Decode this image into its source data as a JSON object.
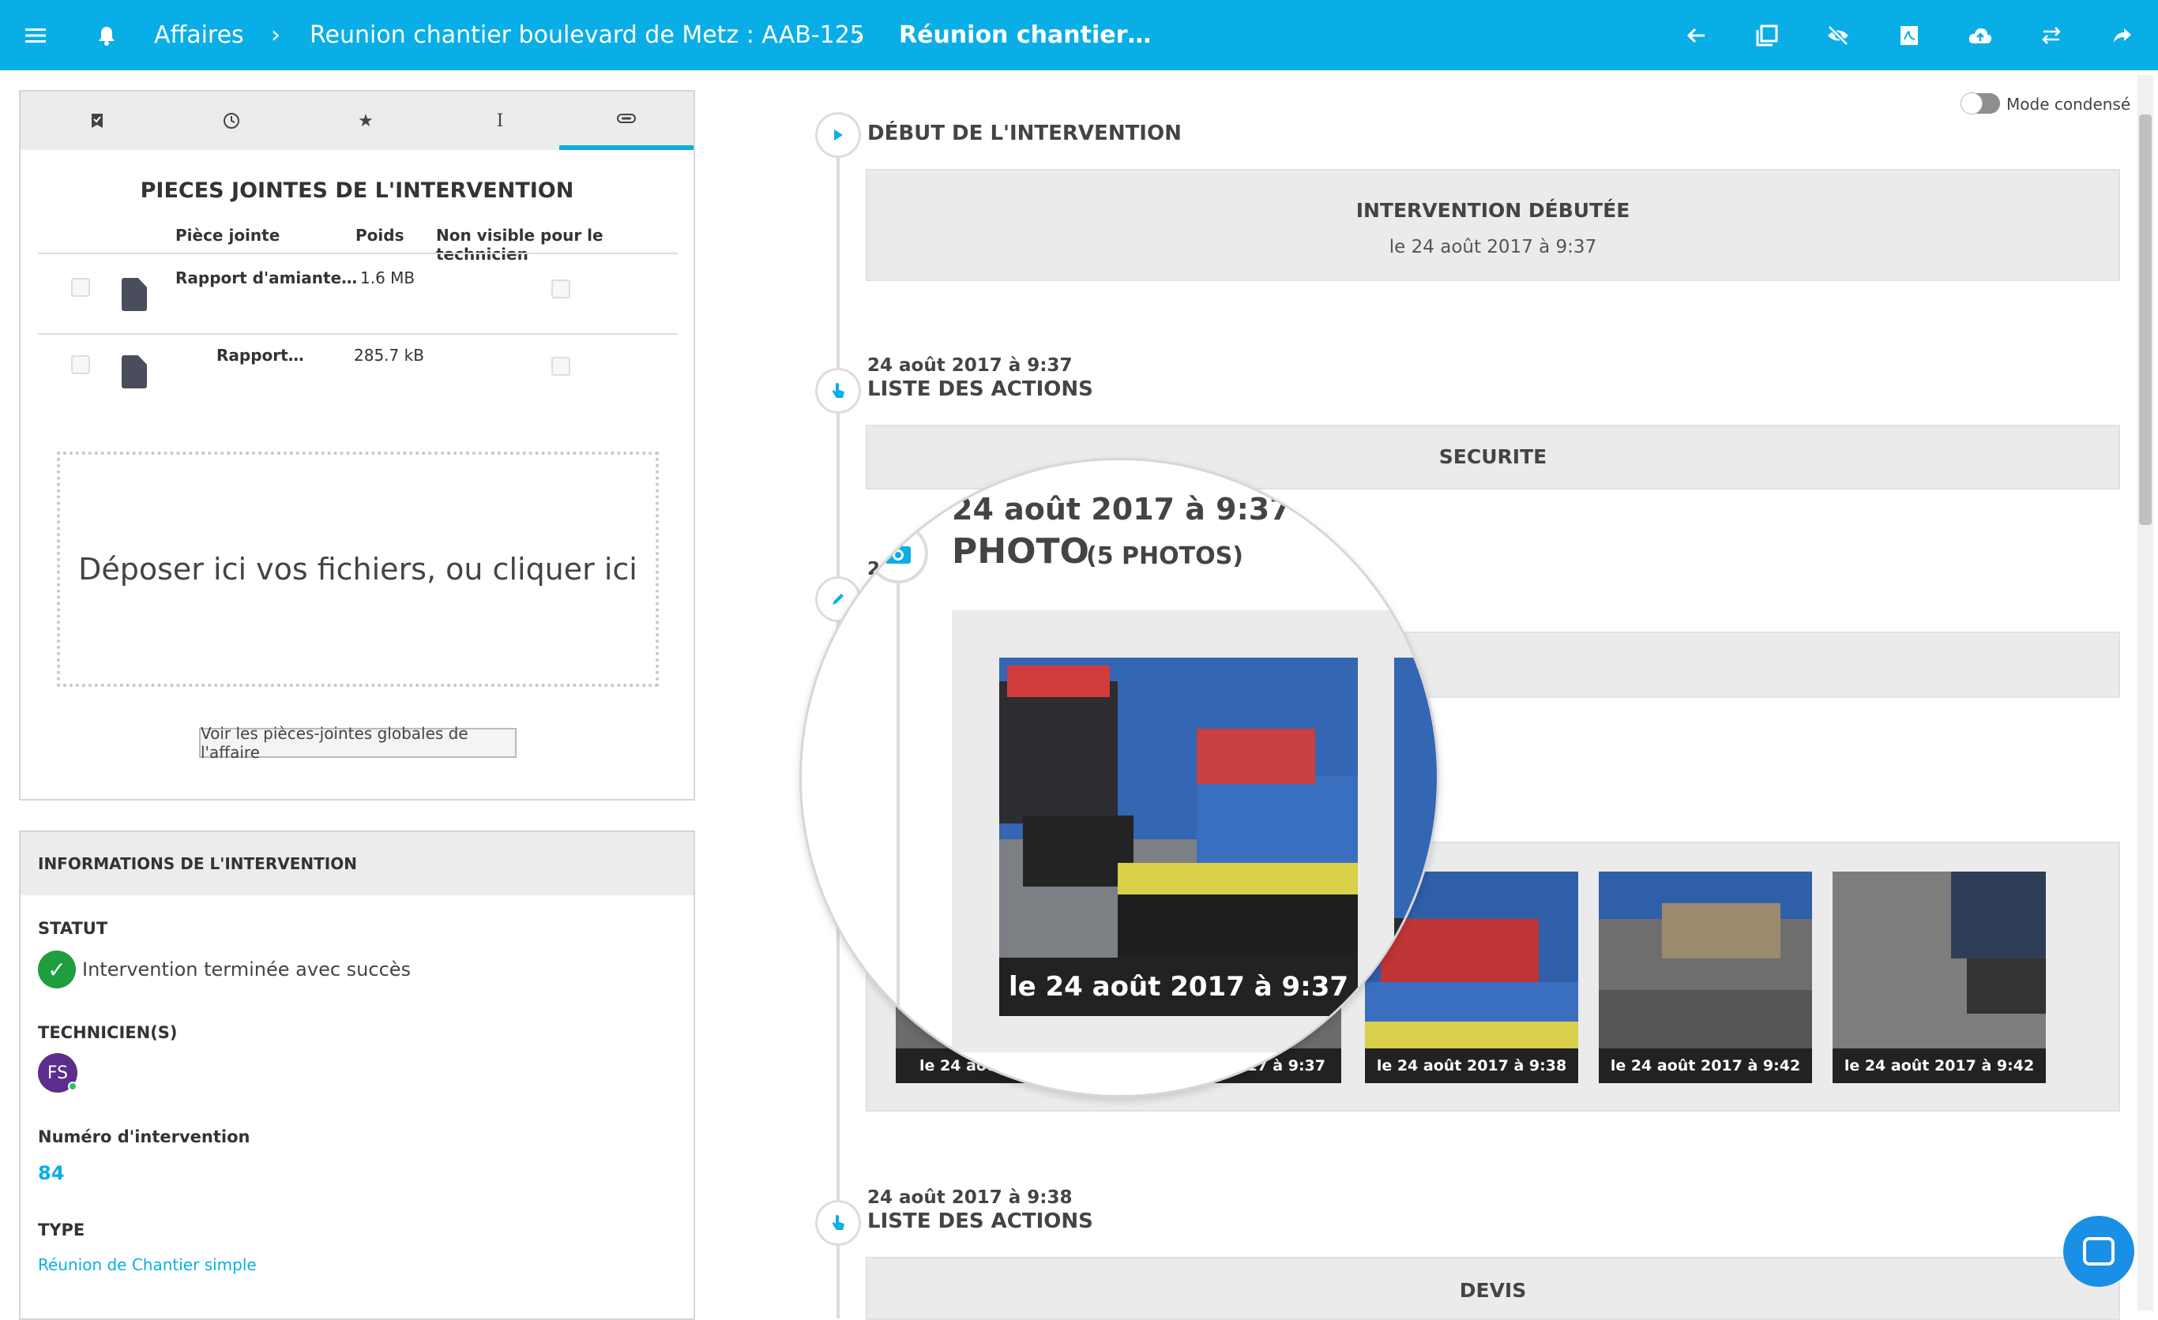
{
  "header": {
    "crumbs": [
      "Affaires",
      "Reunion chantier boulevard de Metz : AAB-125",
      "Réunion chantier…"
    ],
    "icons": [
      "menu-icon",
      "bell-icon",
      "arrow-left-icon",
      "copy-icon",
      "eye-slash-icon",
      "pdf-icon",
      "cloud-upload-icon",
      "swap-icon",
      "share-icon"
    ]
  },
  "tabs": [
    "task-icon",
    "clock-icon",
    "star-icon",
    "text-cursor-icon",
    "paperclip-icon"
  ],
  "attachments": {
    "title": "PIECES JOINTES DE L'INTERVENTION",
    "col_file": "Pièce jointe",
    "col_size": "Poids",
    "col_hidden": "Non visible pour le technicien",
    "rows": [
      {
        "name": "Rapport d'amiante…",
        "size": "1.6 MB"
      },
      {
        "name": "Rapport…",
        "size": "285.7 kB"
      }
    ],
    "dropzone": "Déposer ici vos fichiers, ou cliquer ici",
    "global_button": "Voir les pièces-jointes globales de l'affaire"
  },
  "info": {
    "heading": "INFORMATIONS DE L'INTERVENTION",
    "status_label": "STATUT",
    "status_value": "Intervention terminée avec succès",
    "tech_label": "TECHNICIEN(S)",
    "tech_initials": "FS",
    "num_label": "Numéro d'intervention",
    "num_value": "84",
    "type_label": "TYPE",
    "type_value": "Réunion de Chantier simple"
  },
  "mode_condense": "Mode condensé",
  "timeline": {
    "start_header": "DÉBUT DE L'INTERVENTION",
    "start_box_title": "INTERVENTION DÉBUTÉE",
    "start_box_sub": "le 24 août 2017 à 9:37",
    "actions1_date": "24 août 2017 à 9:37",
    "actions1_header": "LISTE DES ACTIONS",
    "actions1_box": "SECURITE",
    "photo_date_stub": "2",
    "photo_captions": [
      "le 24 aoû",
      "17 à 9:37",
      "le 24 août 2017 à 9:38",
      "le 24 août 2017 à 9:42",
      "le 24 août 2017 à 9:42"
    ],
    "actions2_date": "24 août 2017 à 9:38",
    "actions2_header": "LISTE DES ACTIONS",
    "actions2_box": "DEVIS"
  },
  "magnifier": {
    "date": "24 août 2017 à 9:37",
    "title": "PHOTO",
    "count": "(5 PHOTOS)",
    "caption": "le 24 août 2017 à 9:37"
  },
  "colors": {
    "accent": "#0aaee7",
    "success": "#1e9e3e",
    "avatar": "#5b2d8c"
  }
}
